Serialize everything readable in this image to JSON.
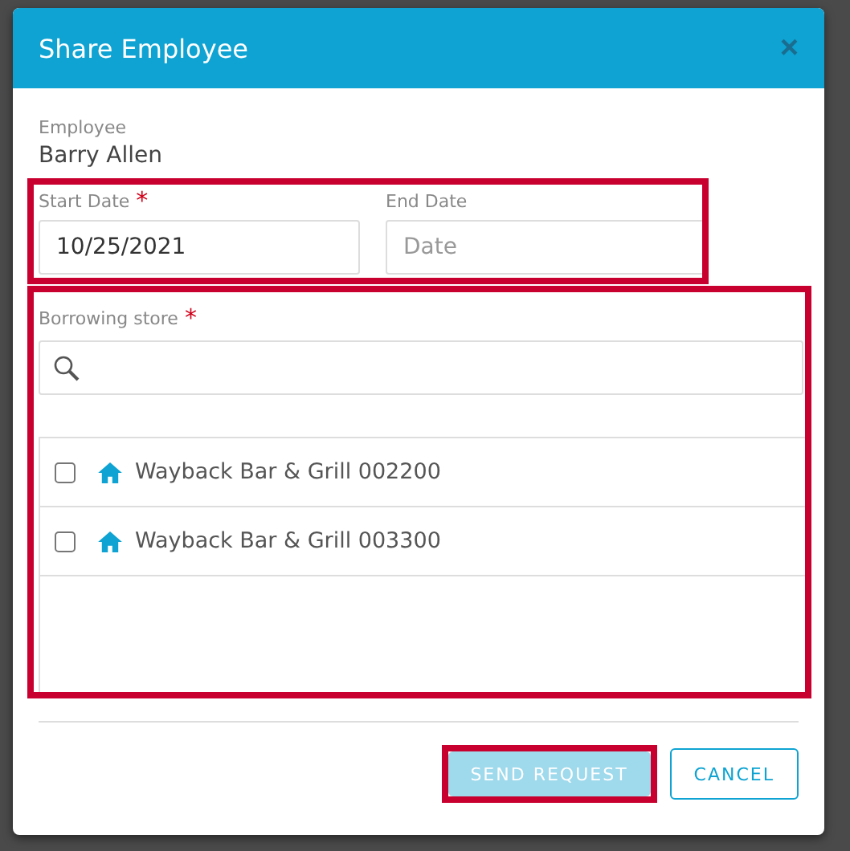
{
  "dialog": {
    "title": "Share Employee",
    "close": "×"
  },
  "employee": {
    "label": "Employee",
    "value": "Barry Allen"
  },
  "dates": [
    {
      "label": "Start Date",
      "required_mark": "*",
      "value": "10/25/2021"
    },
    {
      "label": "End Date",
      "placeholder": "Date"
    }
  ],
  "store": {
    "label": "Borrowing store",
    "required_mark": "*",
    "items": [
      {
        "name": "Wayback Bar & Grill 002200",
        "checked": false
      },
      {
        "name": "Wayback Bar & Grill 003300",
        "checked": false
      }
    ]
  },
  "buttons": [
    {
      "kind": "primary",
      "label": "SEND REQUEST",
      "disabled": true,
      "highlighted": true
    },
    {
      "kind": "secondary",
      "label": "CANCEL",
      "disabled": false,
      "highlighted": false
    }
  ]
}
